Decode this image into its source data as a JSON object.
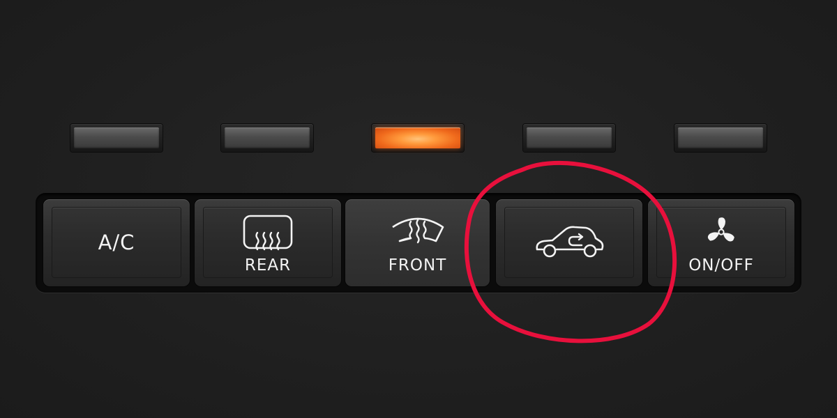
{
  "panel": {
    "buttons": [
      {
        "id": "ac",
        "label": "A/C",
        "icon": "none",
        "indicator_on": false,
        "pressed": false
      },
      {
        "id": "rear",
        "label": "REAR",
        "icon": "rear-defrost-icon",
        "indicator_on": false,
        "pressed": false
      },
      {
        "id": "front",
        "label": "FRONT",
        "icon": "front-defrost-icon",
        "indicator_on": true,
        "pressed": true
      },
      {
        "id": "recirc",
        "label": "",
        "icon": "air-recirculation-icon",
        "indicator_on": false,
        "pressed": false
      },
      {
        "id": "fan",
        "label": "ON/OFF",
        "icon": "fan-icon",
        "indicator_on": false,
        "pressed": false
      }
    ]
  },
  "annotation": {
    "type": "circle",
    "target": "air-recirculation-button",
    "color": "#e8103c"
  },
  "colors": {
    "background": "#1f1f1f",
    "indicator_active": "#f06a1c",
    "indicator_inactive": "#4b4b4b",
    "label": "#f4f4f4"
  }
}
